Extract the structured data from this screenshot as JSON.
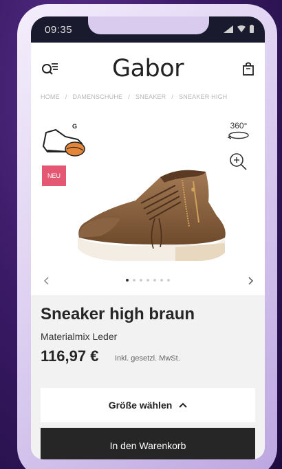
{
  "status_bar": {
    "time": "09:35"
  },
  "header": {
    "logo": "Gabor",
    "breadcrumb": [
      "HOME",
      "DAMENSCHUHE",
      "SNEAKER",
      "SNEAKER HIGH"
    ]
  },
  "gallery": {
    "badge": "NEU",
    "view_360_label": "360°",
    "slide_count": 7,
    "active_slide": 1
  },
  "product": {
    "title": "Sneaker high braun",
    "material": "Materialmix Leder",
    "price": "116,97 €",
    "tax_note": "Inkl. gesetzl. MwSt."
  },
  "actions": {
    "size_label": "Größe wählen",
    "cart_label": "In den Warenkorb"
  },
  "colors": {
    "badge": "#e45874",
    "cart_button": "#262626",
    "background": "#3a1a66"
  }
}
